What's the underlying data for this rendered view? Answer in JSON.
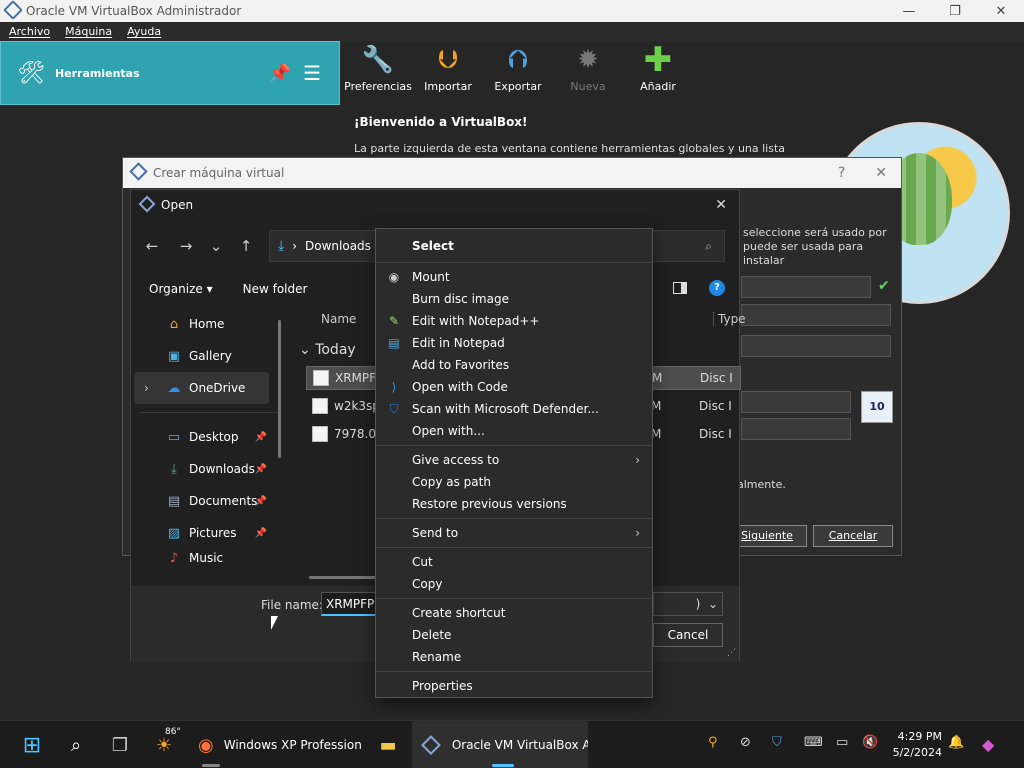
{
  "vbox": {
    "title": "Oracle VM VirtualBox Administrador",
    "menu": [
      "Archivo",
      "Máquina",
      "Ayuda"
    ],
    "tools_label": "Herramientas",
    "toolbar": [
      {
        "label": "Preferencias",
        "icon": "wrench-icon",
        "enabled": true
      },
      {
        "label": "Importar",
        "icon": "import-icon",
        "enabled": true
      },
      {
        "label": "Exportar",
        "icon": "export-icon",
        "enabled": true
      },
      {
        "label": "Nueva",
        "icon": "new-icon",
        "enabled": false
      },
      {
        "label": "Añadir",
        "icon": "add-icon",
        "enabled": true
      }
    ],
    "welcome_title": "¡Bienvenido a VirtualBox!",
    "welcome_text": "La parte izquierda de esta ventana contiene herramientas globales y una lista de todas las"
  },
  "create_vm": {
    "title": "Crear máquina virtual",
    "help": "?",
    "right_text1": "seleccione será usado por puede ser usada para instalar",
    "right_text2": "almente.",
    "next": "Siguiente",
    "cancel": "Cancelar",
    "os_badge": "10"
  },
  "open_dialog": {
    "title": "Open",
    "breadcrumb": "Downloads",
    "organize": "Organize",
    "new_folder": "New folder",
    "col_name": "Name",
    "col_type": "Type",
    "group": "Today",
    "nav": [
      {
        "label": "Home",
        "icon": "home-icon"
      },
      {
        "label": "Gallery",
        "icon": "gallery-icon"
      },
      {
        "label": "OneDrive",
        "icon": "onedrive-icon"
      }
    ],
    "quick": [
      {
        "label": "Desktop",
        "icon": "desktop-icon"
      },
      {
        "label": "Downloads",
        "icon": "downloads-icon"
      },
      {
        "label": "Documents",
        "icon": "documents-icon"
      },
      {
        "label": "Pictures",
        "icon": "pictures-icon"
      },
      {
        "label": "Music",
        "icon": "music-icon"
      }
    ],
    "files": [
      {
        "name": "XRMPFP",
        "mod": "M",
        "type": "Disc I"
      },
      {
        "name": "w2k3sp2",
        "mod": "M",
        "type": "Disc I"
      },
      {
        "name": "7978.0.11",
        "mod": "M",
        "type": "Disc I"
      }
    ],
    "file_name_label": "File name:",
    "file_name_value": "XRMPFPP",
    "file_type_value": ")",
    "cancel": "Cancel"
  },
  "context_menu": {
    "groups": [
      [
        {
          "label": "Select",
          "bold": true
        }
      ],
      [
        {
          "label": "Mount",
          "icon": "disc-icon"
        },
        {
          "label": "Burn disc image"
        },
        {
          "label": "Edit with Notepad++",
          "icon": "notepadpp-icon"
        },
        {
          "label": "Edit in Notepad",
          "icon": "notepad-icon"
        },
        {
          "label": "Add to Favorites"
        },
        {
          "label": "Open with Code",
          "icon": "vscode-icon"
        },
        {
          "label": "Scan with Microsoft Defender...",
          "icon": "defender-icon"
        },
        {
          "label": "Open with..."
        }
      ],
      [
        {
          "label": "Give access to",
          "submenu": true
        },
        {
          "label": "Copy as path"
        },
        {
          "label": "Restore previous versions"
        }
      ],
      [
        {
          "label": "Send to",
          "submenu": true
        }
      ],
      [
        {
          "label": "Cut"
        },
        {
          "label": "Copy"
        }
      ],
      [
        {
          "label": "Create shortcut"
        },
        {
          "label": "Delete"
        },
        {
          "label": "Rename"
        }
      ],
      [
        {
          "label": "Properties"
        }
      ]
    ]
  },
  "taskbar": {
    "temp": "86°",
    "app1": "Windows XP Profession",
    "app2": "Oracle VM VirtualBox A",
    "time": "4:29 PM",
    "date": "5/2/2024"
  }
}
